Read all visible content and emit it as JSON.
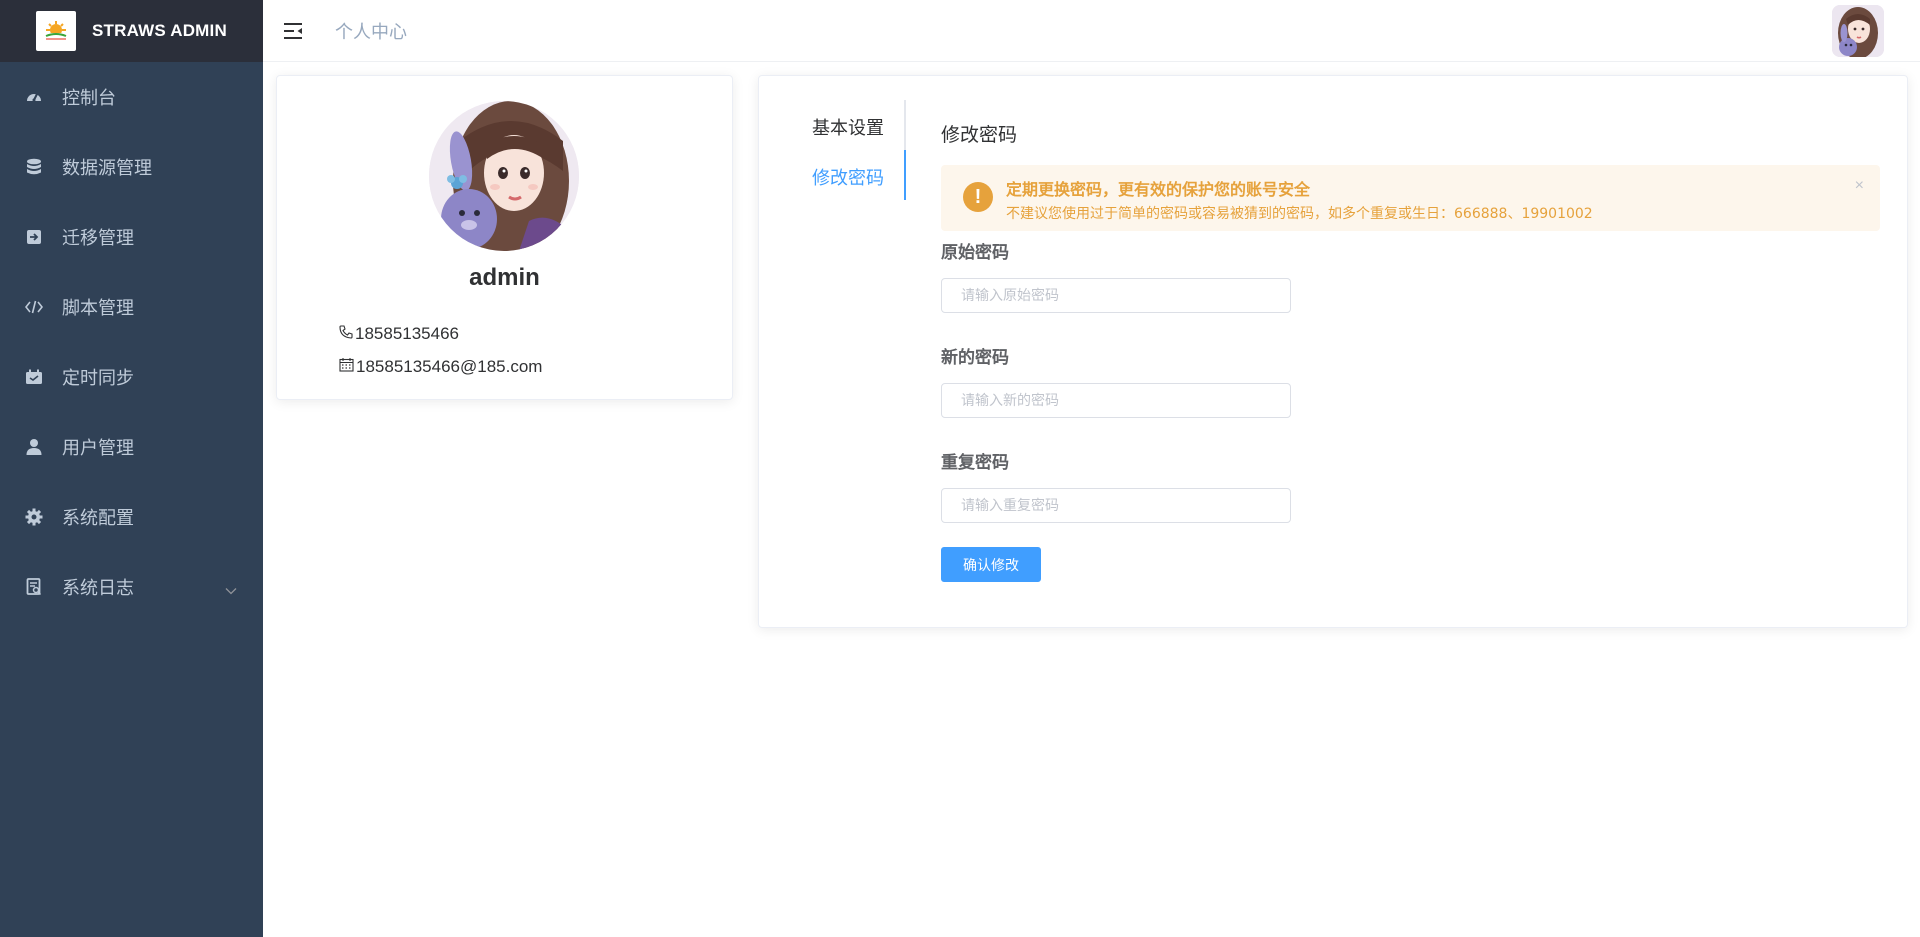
{
  "app": {
    "title": "STRAWS ADMIN"
  },
  "sidebar": {
    "items": [
      {
        "label": "控制台",
        "icon": "dashboard-icon"
      },
      {
        "label": "数据源管理",
        "icon": "database-icon"
      },
      {
        "label": "迁移管理",
        "icon": "migration-icon"
      },
      {
        "label": "脚本管理",
        "icon": "code-icon"
      },
      {
        "label": "定时同步",
        "icon": "schedule-icon"
      },
      {
        "label": "用户管理",
        "icon": "user-icon"
      },
      {
        "label": "系统配置",
        "icon": "gear-icon"
      },
      {
        "label": "系统日志",
        "icon": "log-icon",
        "has_submenu": true
      }
    ]
  },
  "header": {
    "breadcrumb": "个人中心"
  },
  "profile": {
    "username": "admin",
    "phone": "18585135466",
    "email": "18585135466@185.com"
  },
  "tabs": {
    "basic": "基本设置",
    "password": "修改密码",
    "active": "password"
  },
  "password_form": {
    "title": "修改密码",
    "alert_title": "定期更换密码，更有效的保护您的账号安全",
    "alert_desc": "不建议您使用过于简单的密码或容易被猜到的密码，如多个重复或生日：666888、19901002",
    "alert_close": "×",
    "old_label": "原始密码",
    "old_placeholder": "请输入原始密码",
    "new_label": "新的密码",
    "new_placeholder": "请输入新的密码",
    "repeat_label": "重复密码",
    "repeat_placeholder": "请输入重复密码",
    "submit_label": "确认修改"
  },
  "colors": {
    "sidebar_bg": "#304156",
    "logo_bg": "#2b2f3a",
    "menu_text": "#bfcbd9",
    "primary": "#409eff",
    "warning": "#e6a23c",
    "warning_bg": "#fdf6ec"
  }
}
